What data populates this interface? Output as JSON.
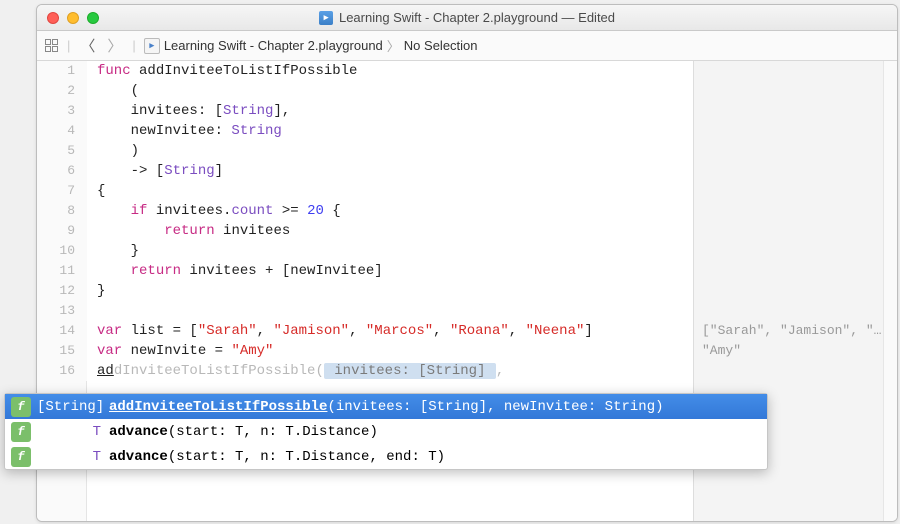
{
  "window": {
    "title": "Learning Swift - Chapter 2.playground — Edited",
    "icon_glyph": "▸"
  },
  "navbar": {
    "breadcrumb_file": "Learning Swift - Chapter 2.playground",
    "breadcrumb_selection": "No Selection"
  },
  "code": {
    "lines": [
      {
        "n": "1",
        "tokens": [
          [
            "kw",
            "func"
          ],
          [
            "",
            " "
          ],
          [
            "ident",
            "addInviteeToListIfPossible"
          ]
        ]
      },
      {
        "n": "2",
        "tokens": [
          [
            "",
            "    ("
          ]
        ]
      },
      {
        "n": "3",
        "tokens": [
          [
            "",
            "    invitees: ["
          ],
          [
            "type",
            "String"
          ],
          [
            "",
            "],"
          ]
        ]
      },
      {
        "n": "4",
        "tokens": [
          [
            "",
            "    newInvitee: "
          ],
          [
            "type",
            "String"
          ]
        ]
      },
      {
        "n": "5",
        "tokens": [
          [
            "",
            "    )"
          ]
        ]
      },
      {
        "n": "6",
        "tokens": [
          [
            "",
            "    -> ["
          ],
          [
            "type",
            "String"
          ],
          [
            "",
            "]"
          ]
        ]
      },
      {
        "n": "7",
        "tokens": [
          [
            "",
            "{"
          ]
        ]
      },
      {
        "n": "8",
        "tokens": [
          [
            "",
            "    "
          ],
          [
            "kw",
            "if"
          ],
          [
            "",
            " invitees."
          ],
          [
            "type",
            "count"
          ],
          [
            "",
            " >= "
          ],
          [
            "num",
            "20"
          ],
          [
            "",
            " {"
          ]
        ]
      },
      {
        "n": "9",
        "tokens": [
          [
            "",
            "        "
          ],
          [
            "kw",
            "return"
          ],
          [
            "",
            " invitees"
          ]
        ]
      },
      {
        "n": "10",
        "tokens": [
          [
            "",
            "    }"
          ]
        ]
      },
      {
        "n": "11",
        "tokens": [
          [
            "",
            "    "
          ],
          [
            "kw",
            "return"
          ],
          [
            "",
            " invitees + [newInvitee]"
          ]
        ]
      },
      {
        "n": "12",
        "tokens": [
          [
            "",
            "}"
          ]
        ]
      },
      {
        "n": "13",
        "tokens": [
          [
            "",
            ""
          ]
        ]
      },
      {
        "n": "14",
        "tokens": [
          [
            "kw",
            "var"
          ],
          [
            "",
            " list = ["
          ],
          [
            "str",
            "\"Sarah\""
          ],
          [
            "",
            ", "
          ],
          [
            "str",
            "\"Jamison\""
          ],
          [
            "",
            ", "
          ],
          [
            "str",
            "\"Marcos\""
          ],
          [
            "",
            ", "
          ],
          [
            "str",
            "\"Roana\""
          ],
          [
            "",
            ", "
          ],
          [
            "str",
            "\"Neena\""
          ],
          [
            "",
            "]"
          ]
        ]
      },
      {
        "n": "15",
        "tokens": [
          [
            "kw",
            "var"
          ],
          [
            "",
            " newInvite = "
          ],
          [
            "str",
            "\"Amy\""
          ]
        ]
      },
      {
        "n": "16",
        "typed": "ad",
        "ghost_prefix": "d",
        "ghost_rest": "InviteeToListIfPossible(",
        "ghost_param": " invitees: [String] ",
        "ghost_tail": ","
      }
    ]
  },
  "results": {
    "14": "[\"Sarah\", \"Jamison\", \"…",
    "15": "\"Amy\""
  },
  "autocomplete": {
    "items": [
      {
        "ret": "[String]",
        "name": "addInviteeToListIfPossible",
        "params": "(invitees: [String], newInvitee: String)",
        "selected": true
      },
      {
        "ret": "T",
        "name": "advance",
        "params": "(start: T, n: T.Distance)",
        "selected": false
      },
      {
        "ret": "T",
        "name": "advance",
        "params": "(start: T, n: T.Distance, end: T)",
        "selected": false
      }
    ],
    "icon_glyph": "f"
  }
}
